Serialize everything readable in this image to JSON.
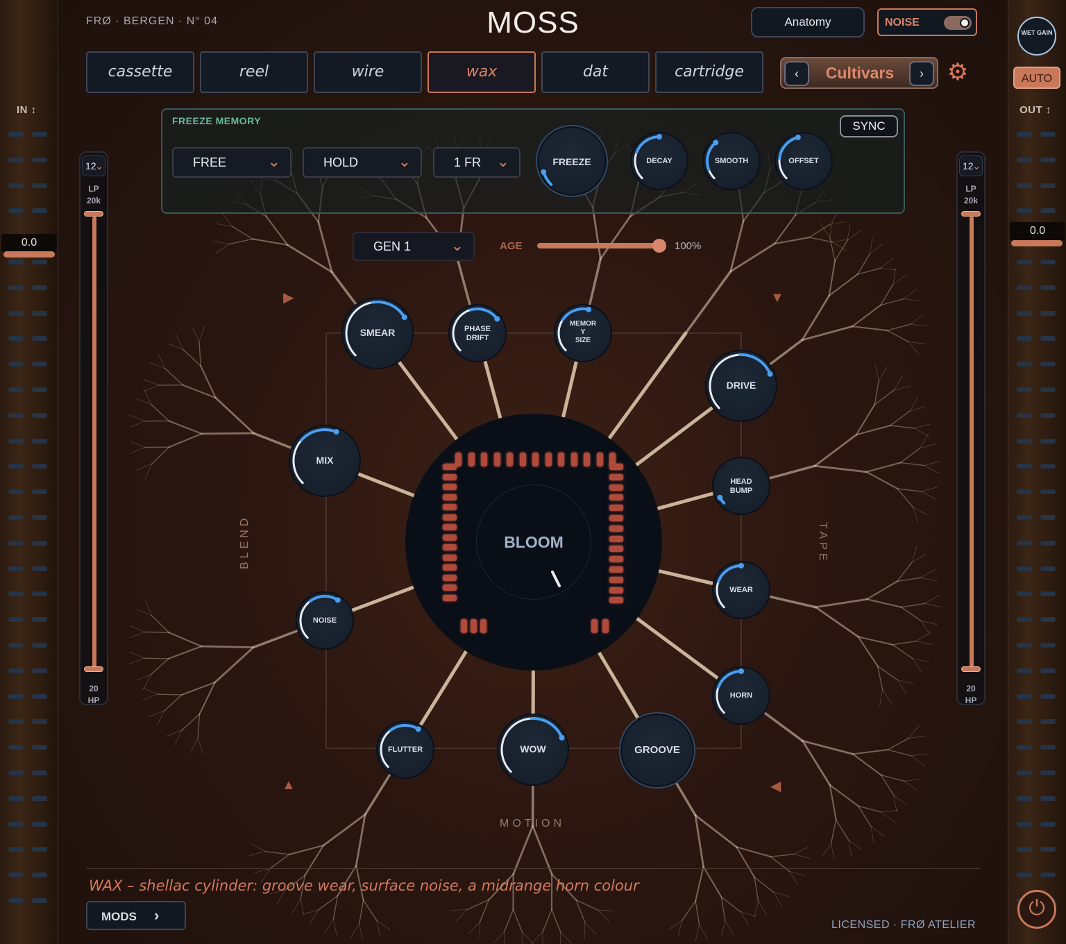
{
  "header": {
    "brand_parts": [
      "FRØ",
      "·",
      "BERGEN",
      "·",
      "N° 04"
    ],
    "brand_text": "FRØ  ·  BERGEN  ·  N° 04",
    "title": "MOSS",
    "anatomy_label": "Anatomy",
    "noise_label": "NOISE",
    "noise_on": true
  },
  "tape_tabs": [
    "cassette",
    "reel",
    "wire",
    "wax",
    "dat",
    "cartridge"
  ],
  "active_tab": "wax",
  "cultivars": {
    "label": "Cultivars",
    "prev": "‹",
    "next": "›"
  },
  "left_rail": {
    "label": "IN ↕",
    "value": "0.0"
  },
  "right_rail": {
    "label": "OUT ↕",
    "value": "0.0",
    "wet_gain": "WET GAIN",
    "auto": "AUTO"
  },
  "freeze_memory": {
    "title": "FREEZE MEMORY",
    "sync": "SYNC",
    "mode": "FREE",
    "hold": "HOLD",
    "frames": "1 FR",
    "freeze": "FREEZE",
    "knobs": [
      "DECAY",
      "SMOOTH",
      "OFFSET"
    ]
  },
  "filters": {
    "left": {
      "slope": "12",
      "lp_label": "LP",
      "lp_value": "20k",
      "hp_value": "20",
      "hp_label": "HP"
    },
    "right": {
      "slope": "12",
      "lp_label": "LP",
      "lp_value": "20k",
      "hp_value": "20",
      "hp_label": "HP"
    }
  },
  "generation": {
    "value": "GEN 1",
    "age_label": "AGE",
    "age_value": "100%",
    "age_fraction": 1.0
  },
  "sections": {
    "blend": "BLEND",
    "tape": "TAPE",
    "motion": "MOTION"
  },
  "knobs": {
    "smear": {
      "label": "SMEAR",
      "level": 0.72
    },
    "phase_drift": {
      "label_1": "PHASE",
      "label_2": "DRIFT",
      "level": 0.7
    },
    "memory_size": {
      "label_1": "MEMOR",
      "label_2": "Y",
      "label_3": "SIZE",
      "level": 0.55
    },
    "drive": {
      "label": "DRIVE",
      "level": 0.75
    },
    "mix": {
      "label": "MIX",
      "level": 0.58
    },
    "head_bump": {
      "label_1": "HEAD",
      "label_2": "BUMP",
      "level": 0.06
    },
    "noise": {
      "label": "NOISE",
      "level": 0.62
    },
    "wear": {
      "label": "WEAR",
      "level": 0.5
    },
    "horn": {
      "label": "HORN",
      "level": 0.5
    },
    "flutter": {
      "label": "FLUTTER",
      "level": 0.62
    },
    "wow": {
      "label": "WOW",
      "level": 0.75
    },
    "groove": {
      "label": "GROOVE"
    },
    "bloom": {
      "label": "BLOOM"
    }
  },
  "description": "WAX – shellac cylinder: groove wear, surface noise, a midrange horn colour",
  "mods_label": "MODS",
  "footer": "LICENSED  ·  FRØ ATELIER",
  "colors": {
    "accent": "#c9785a",
    "knob_arc": "#4a9ef0",
    "panel_teal": "#6ab8a0"
  }
}
